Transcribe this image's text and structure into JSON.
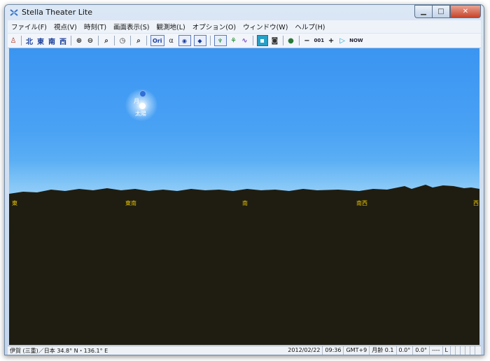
{
  "window": {
    "title": "Stella Theater Lite"
  },
  "menu": [
    "ファイル(F)",
    "視点(V)",
    "時刻(T)",
    "画面表示(S)",
    "観測地(L)",
    "オプション(O)",
    "ウィンドウ(W)",
    "ヘルプ(H)"
  ],
  "toolbar": {
    "dir_north": "北",
    "dir_east": "東",
    "dir_south": "南",
    "dir_west": "西",
    "ori_label": "Ori",
    "alpha_label": "α",
    "step_value": "001",
    "now_label": "NOW"
  },
  "sky": {
    "moon_label": "月",
    "sun_label": "太陽"
  },
  "horizon": {
    "dirs": [
      "東",
      "東南",
      "南",
      "南西",
      "西"
    ]
  },
  "status": {
    "location": "伊賀 (三重)／日本  34.8° N・136.1° E",
    "date": "2012/02/22",
    "time": "09:36",
    "tz": "GMT+9",
    "moon_age": "月齢 0.1",
    "val1": "0.0°",
    "val2": "0.0°",
    "dashes": "----",
    "mode": "L"
  }
}
